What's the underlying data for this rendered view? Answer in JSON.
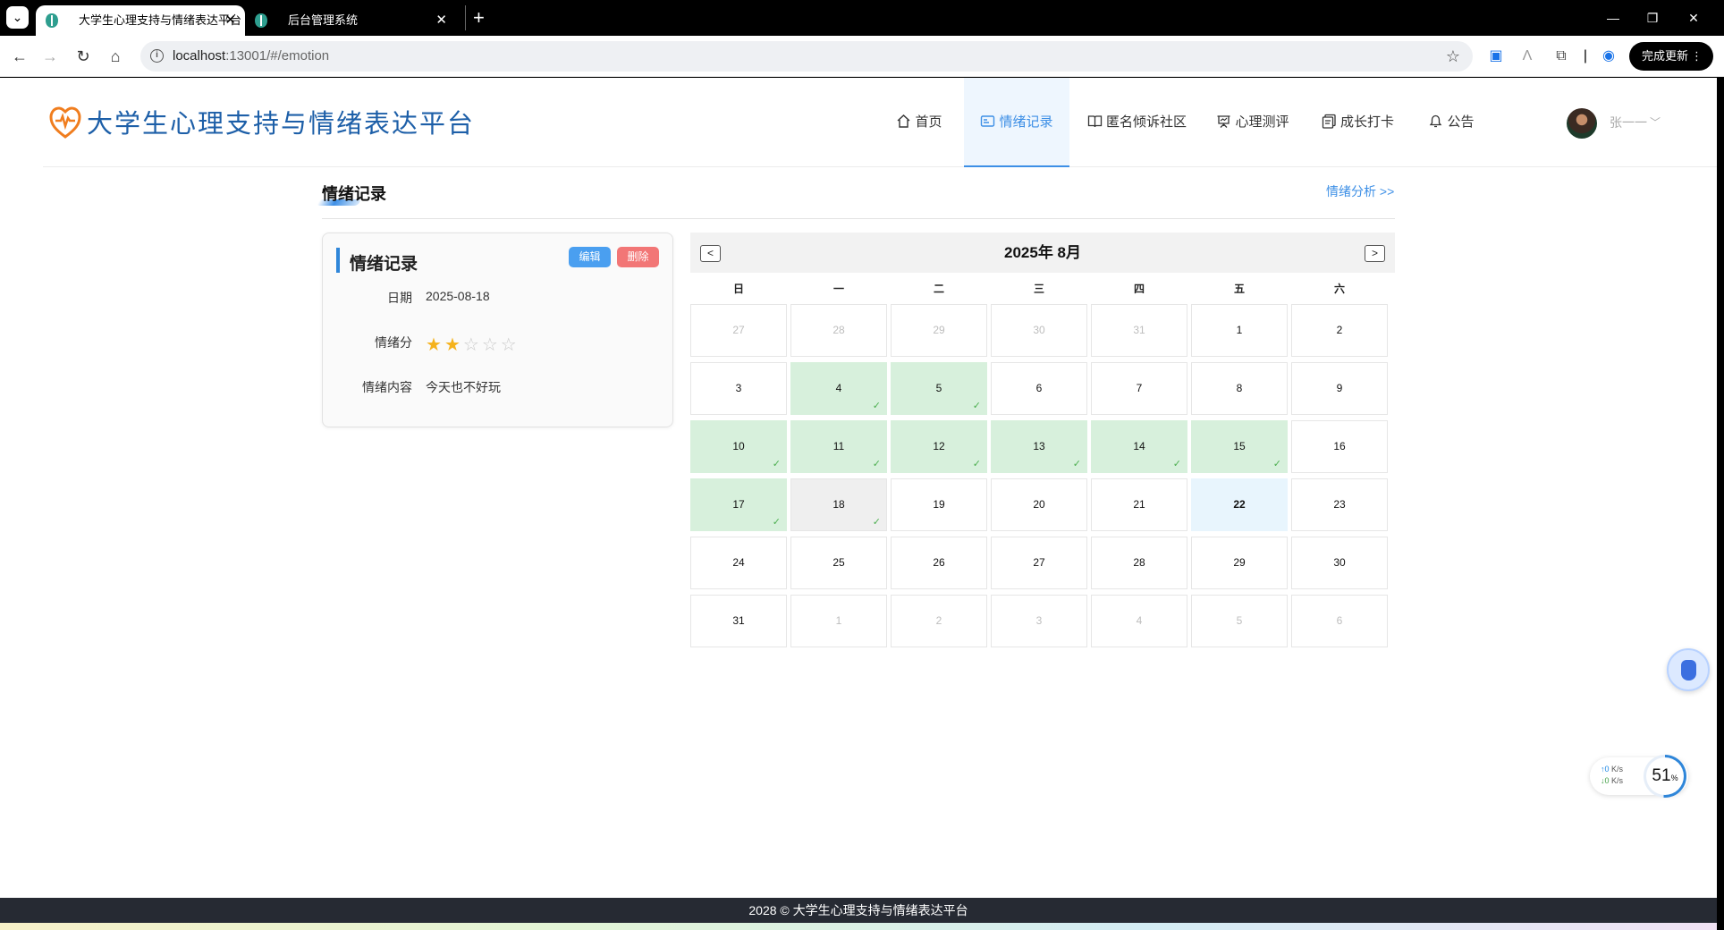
{
  "browser": {
    "tabs": [
      {
        "title": "大学生心理支持与情绪表达平台",
        "active": true
      },
      {
        "title": "后台管理系统",
        "active": false
      }
    ],
    "url_host": "localhost",
    "url_rest": ":13001/#/emotion",
    "update_button": "完成更新"
  },
  "header": {
    "site_title": "大学生心理支持与情绪表达平台",
    "nav": [
      {
        "label": "首页",
        "icon": "home-icon",
        "active": false
      },
      {
        "label": "情绪记录",
        "icon": "emotion-record-icon",
        "active": true
      },
      {
        "label": "匿名倾诉社区",
        "icon": "book-icon",
        "active": false
      },
      {
        "label": "心理测评",
        "icon": "presentation-icon",
        "active": false
      },
      {
        "label": "成长打卡",
        "icon": "checkin-icon",
        "active": false
      },
      {
        "label": "公告",
        "icon": "bell-icon",
        "active": false
      }
    ],
    "user_name": "张一一"
  },
  "section": {
    "title": "情绪记录",
    "analysis_link": "情绪分析 >>"
  },
  "record": {
    "title": "情绪记录",
    "edit_label": "编辑",
    "delete_label": "删除",
    "date_label": "日期",
    "date_value": "2025-08-18",
    "score_label": "情绪分",
    "score_value": 2,
    "score_max": 5,
    "content_label": "情绪内容",
    "content_value": "今天也不好玩"
  },
  "calendar": {
    "title": "2025年 8月",
    "prev_label": "<",
    "next_label": ">",
    "weekdays": [
      "日",
      "一",
      "二",
      "三",
      "四",
      "五",
      "六"
    ],
    "check_mark": "✓",
    "days": [
      {
        "label": "27",
        "state": "other"
      },
      {
        "label": "28",
        "state": "other"
      },
      {
        "label": "29",
        "state": "other"
      },
      {
        "label": "30",
        "state": "other"
      },
      {
        "label": "31",
        "state": "other"
      },
      {
        "label": "1",
        "state": "normal"
      },
      {
        "label": "2",
        "state": "normal"
      },
      {
        "label": "3",
        "state": "normal"
      },
      {
        "label": "4",
        "state": "recorded"
      },
      {
        "label": "5",
        "state": "recorded"
      },
      {
        "label": "6",
        "state": "normal"
      },
      {
        "label": "7",
        "state": "normal"
      },
      {
        "label": "8",
        "state": "normal"
      },
      {
        "label": "9",
        "state": "normal"
      },
      {
        "label": "10",
        "state": "recorded"
      },
      {
        "label": "11",
        "state": "recorded"
      },
      {
        "label": "12",
        "state": "recorded"
      },
      {
        "label": "13",
        "state": "recorded"
      },
      {
        "label": "14",
        "state": "recorded"
      },
      {
        "label": "15",
        "state": "recorded"
      },
      {
        "label": "16",
        "state": "normal"
      },
      {
        "label": "17",
        "state": "recorded"
      },
      {
        "label": "18",
        "state": "selected"
      },
      {
        "label": "19",
        "state": "normal"
      },
      {
        "label": "20",
        "state": "normal"
      },
      {
        "label": "21",
        "state": "normal"
      },
      {
        "label": "22",
        "state": "today"
      },
      {
        "label": "23",
        "state": "normal"
      },
      {
        "label": "24",
        "state": "normal"
      },
      {
        "label": "25",
        "state": "normal"
      },
      {
        "label": "26",
        "state": "normal"
      },
      {
        "label": "27",
        "state": "normal"
      },
      {
        "label": "28",
        "state": "normal"
      },
      {
        "label": "29",
        "state": "normal"
      },
      {
        "label": "30",
        "state": "normal"
      },
      {
        "label": "31",
        "state": "normal"
      },
      {
        "label": "1",
        "state": "other"
      },
      {
        "label": "2",
        "state": "other"
      },
      {
        "label": "3",
        "state": "other"
      },
      {
        "label": "4",
        "state": "other"
      },
      {
        "label": "5",
        "state": "other"
      },
      {
        "label": "6",
        "state": "other"
      }
    ]
  },
  "netmon": {
    "up": "↑0",
    "down": "↓0",
    "unit": "K/s",
    "cpu_value": "51",
    "cpu_unit": "%",
    "cpu_percent": 51
  },
  "footer": {
    "text": "2028 © 大学生心理支持与情绪表达平台"
  },
  "colors": {
    "brand": "#1d5fa8",
    "accent": "#3d8fe6",
    "recorded_day": "#d7f0dc",
    "today": "#e8f5fd",
    "star": "#f5b21c",
    "delete": "#f27676"
  }
}
